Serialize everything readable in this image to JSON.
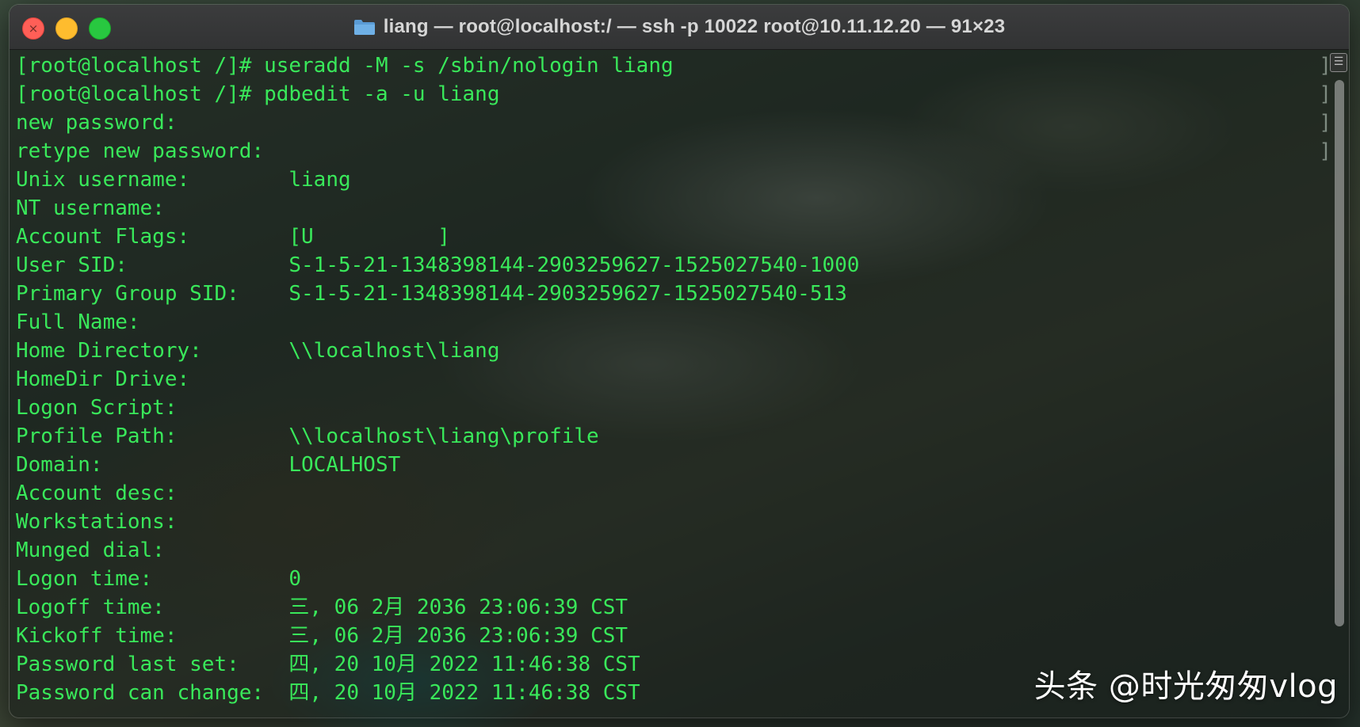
{
  "window": {
    "title": "liang — root@localhost:/ — ssh -p 10022 root@10.11.12.20 — 91×23",
    "icons": {
      "close": "close-icon",
      "minimize": "minimize-icon",
      "zoom": "zoom-icon",
      "folder": "folder-icon"
    }
  },
  "terminal": {
    "lines": [
      "[root@localhost /]# useradd -M -s /sbin/nologin liang",
      "[root@localhost /]# pdbedit -a -u liang",
      "new password:",
      "retype new password:",
      "Unix username:        liang",
      "NT username:",
      "Account Flags:        [U          ]",
      "User SID:             S-1-5-21-1348398144-2903259627-1525027540-1000",
      "Primary Group SID:    S-1-5-21-1348398144-2903259627-1525027540-513",
      "Full Name:",
      "Home Directory:       \\\\localhost\\liang",
      "HomeDir Drive:",
      "Logon Script:",
      "Profile Path:         \\\\localhost\\liang\\profile",
      "Domain:               LOCALHOST",
      "Account desc:",
      "Workstations:",
      "Munged dial:",
      "Logon time:           0",
      "Logoff time:          三, 06 2月 2036 23:06:39 CST",
      "Kickoff time:         三, 06 2月 2036 23:06:39 CST",
      "Password last set:    四, 20 10月 2022 11:46:38 CST",
      "Password can change:  四, 20 10月 2022 11:46:38 CST"
    ],
    "color": "#39e85a"
  },
  "watermark": {
    "text": "头条 @时光匆匆vlog"
  },
  "colors": {
    "titlebar": "#3b3c3d",
    "close": "#ff5f57",
    "minimize": "#febc2e",
    "zoom": "#28c840"
  }
}
